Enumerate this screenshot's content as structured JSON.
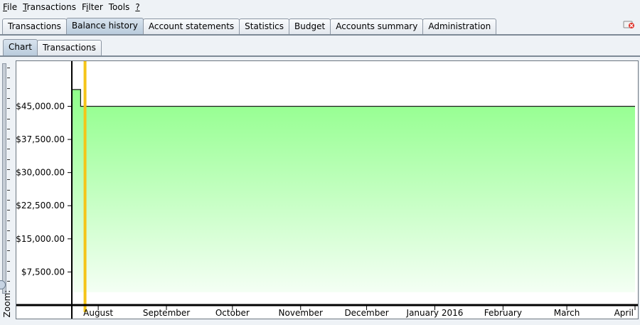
{
  "menu": {
    "items": [
      {
        "mnemonic": "F",
        "rest": "ile"
      },
      {
        "mnemonic": "T",
        "rest": "ransactions"
      },
      {
        "pre": "F",
        "mnemonic": "i",
        "rest": "lter"
      },
      {
        "pre": "Tools",
        "mnemonic": "",
        "rest": ""
      },
      {
        "mnemonic": "?",
        "rest": ""
      }
    ]
  },
  "tabs": {
    "main": [
      "Transactions",
      "Balance history",
      "Account statements",
      "Statistics",
      "Budget",
      "Accounts summary",
      "Administration"
    ],
    "active_main": "Balance history",
    "sub": [
      "Chart",
      "Transactions"
    ],
    "active_sub": "Chart"
  },
  "zoom": {
    "label": "Zoom:",
    "level": 0.05
  },
  "colors": {
    "fill_top": "#8fff8a",
    "fill_bottom": "#f4fff4",
    "cursor": "#f5c518",
    "axis": "#000000"
  },
  "chart_data": {
    "type": "area",
    "title": "",
    "ylim": [
      0,
      52000
    ],
    "yticks": [
      {
        "value": 7500,
        "label": "$7,500.00"
      },
      {
        "value": 15000,
        "label": "$15,000.00"
      },
      {
        "value": 22500,
        "label": "$22,500.00"
      },
      {
        "value": 30000,
        "label": "$30,000.00"
      },
      {
        "value": 37500,
        "label": "$37,500.00"
      },
      {
        "value": 45000,
        "label": "$45,000.00"
      }
    ],
    "xlim": [
      "2015-07-20",
      "2016-04-01"
    ],
    "xticks": [
      {
        "date": "2015-08-01",
        "label": "August"
      },
      {
        "date": "2015-09-01",
        "label": "September"
      },
      {
        "date": "2015-10-01",
        "label": "October"
      },
      {
        "date": "2015-11-01",
        "label": "November"
      },
      {
        "date": "2015-12-01",
        "label": "December"
      },
      {
        "date": "2016-01-01",
        "label": "January 2016"
      },
      {
        "date": "2016-02-01",
        "label": "February"
      },
      {
        "date": "2016-03-01",
        "label": "March"
      },
      {
        "date": "2016-04-01",
        "label": "April"
      }
    ],
    "series": [
      {
        "points": [
          {
            "date": "2015-07-20",
            "value": 48800
          },
          {
            "date": "2015-07-24",
            "value": 45000
          },
          {
            "date": "2016-04-01",
            "value": 45000
          }
        ]
      }
    ],
    "cursor_date": "2015-07-26",
    "grid": false
  }
}
